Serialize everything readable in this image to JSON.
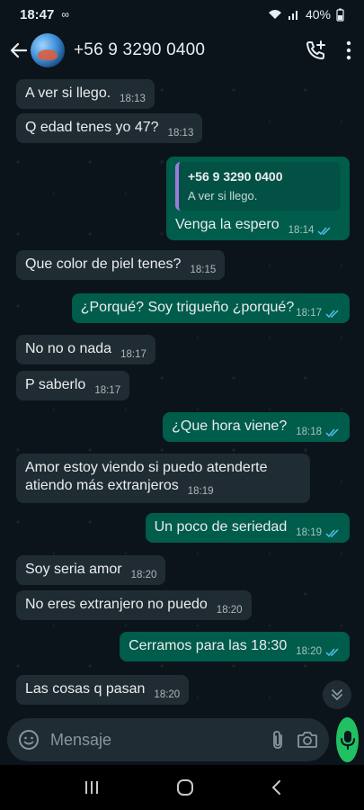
{
  "status": {
    "time": "18:47",
    "extra": "∞",
    "battery": "40%"
  },
  "header": {
    "contact": "+56 9 3290 0400"
  },
  "messages": [
    {
      "dir": "in",
      "text": "A ver si llego.",
      "time": "18:13"
    },
    {
      "dir": "in",
      "text": "Q edad tenes yo 47?",
      "time": "18:13"
    },
    {
      "dir": "out",
      "reply_name": "+56 9 3290 0400",
      "reply_text": "A ver si llego.",
      "text": "Venga la espero",
      "time": "18:14"
    },
    {
      "dir": "in",
      "text": "Que color de piel tenes?",
      "time": "18:15"
    },
    {
      "dir": "out",
      "text": "¿Porqué? Soy trigueño ¿porqué?",
      "time": "18:17"
    },
    {
      "dir": "in",
      "text": "No no o nada",
      "time": "18:17"
    },
    {
      "dir": "in",
      "text": "P saberlo",
      "time": "18:17"
    },
    {
      "dir": "out",
      "text": "¿Que hora viene?",
      "time": "18:18"
    },
    {
      "dir": "in",
      "text": "Amor estoy viendo si puedo atenderte atiendo más extranjeros",
      "time": "18:19"
    },
    {
      "dir": "out",
      "text": "Un poco de seriedad",
      "time": "18:19"
    },
    {
      "dir": "in",
      "text": "Soy seria amor",
      "time": "18:20"
    },
    {
      "dir": "in",
      "text": "No eres extranjero no puedo",
      "time": "18:20"
    },
    {
      "dir": "out",
      "text": "Cerramos para las 18:30",
      "time": "18:20"
    },
    {
      "dir": "in",
      "text": "Las cosas q pasan",
      "time": "18:20"
    }
  ],
  "input": {
    "placeholder": "Mensaje"
  },
  "colors": {
    "accent": "#21c063",
    "outgoing": "#005c4b",
    "incoming": "#202c33",
    "read_ticks": "#53bdeb"
  }
}
